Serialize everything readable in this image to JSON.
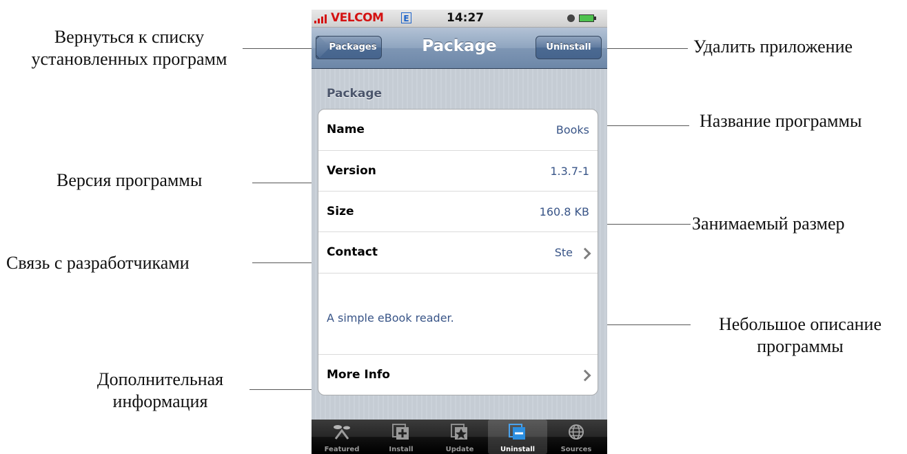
{
  "annotations": {
    "back": [
      "Вернуться к списку",
      "установленных программ"
    ],
    "uninstall": "Удалить приложение",
    "name": "Название программы",
    "version": "Версия  программы",
    "size": "Занимаемый размер",
    "contact": "Связь с разработчиками",
    "description": [
      "Небольшое описание",
      "программы"
    ],
    "more_info": [
      "Дополнительная",
      "информация"
    ]
  },
  "status_bar": {
    "carrier": "VELCOM",
    "network": "E",
    "time": "14:27"
  },
  "nav_bar": {
    "back_label": "Packages",
    "title": "Package",
    "uninstall_label": "Uninstall"
  },
  "section": {
    "header": "Package",
    "rows": {
      "name": {
        "label": "Name",
        "value": "Books"
      },
      "version": {
        "label": "Version",
        "value": "1.3.7-1"
      },
      "size": {
        "label": "Size",
        "value": "160.8 KB"
      },
      "contact": {
        "label": "Contact",
        "value": "Ste"
      },
      "description": "A simple eBook reader.",
      "more_info": {
        "label": "More Info"
      }
    }
  },
  "tab_bar": {
    "tabs": [
      {
        "label": "Featured",
        "icon": "featured-icon",
        "selected": false
      },
      {
        "label": "Install",
        "icon": "install-icon",
        "selected": false
      },
      {
        "label": "Update",
        "icon": "update-icon",
        "selected": false
      },
      {
        "label": "Uninstall",
        "icon": "uninstall-icon",
        "selected": true
      },
      {
        "label": "Sources",
        "icon": "sources-icon",
        "selected": false
      }
    ]
  }
}
